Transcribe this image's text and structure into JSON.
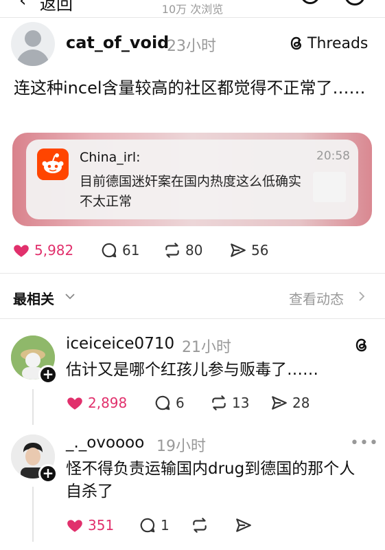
{
  "topbar": {
    "back_label": "返回",
    "views": "10万 次浏览"
  },
  "post": {
    "username": "cat_of_void",
    "time": "23小时",
    "source": "Threads",
    "text": "连这种incel含量较高的社区都觉得不正常了……",
    "notification": {
      "sender": "China_irl:",
      "time": "20:58",
      "body": "目前德国迷奸案在国内热度这么低确实不太正常"
    },
    "stats": {
      "likes": "5,982",
      "comments": "61",
      "reposts": "80",
      "shares": "56"
    }
  },
  "sort": {
    "label": "最相关",
    "activity": "查看动态"
  },
  "comments": [
    {
      "username": "iceiceice0710",
      "time": "21小时",
      "text": "估计又是哪个红孩儿参与贩毒了……",
      "likes": "2,898",
      "comments": "6",
      "reposts": "13",
      "shares": "28"
    },
    {
      "username": "_._ovoooo",
      "time": "19小时",
      "text": "怪不得负责运输国内drug到德国的那个人自杀了",
      "likes": "351",
      "comments": "1",
      "reposts": "",
      "shares": ""
    }
  ],
  "colors": {
    "like": "#e1306c",
    "muted": "#999999",
    "reddit": "#ff4500"
  },
  "icons": [
    "heart-icon",
    "comment-icon",
    "repost-icon",
    "share-icon",
    "threads-logo-icon",
    "reddit-icon",
    "chevron-down-icon",
    "chevron-right-icon",
    "more-icon",
    "add-follow-icon"
  ]
}
